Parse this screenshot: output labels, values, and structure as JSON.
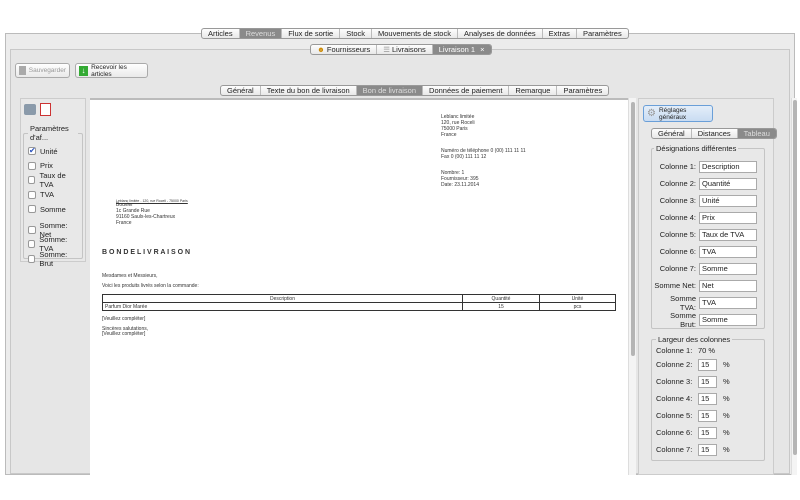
{
  "main_tabs": [
    "Articles",
    "Revenus",
    "Flux de sortie",
    "Stock",
    "Mouvements de stock",
    "Analyses de données",
    "Extras",
    "Paramètres"
  ],
  "sub_tabs": {
    "fournisseurs": "Fournisseurs",
    "livraisons": "Livraisons",
    "livraison1": "Livraison 1",
    "close": "×"
  },
  "toolbar": {
    "save": "Sauvegarder",
    "receive": "Recevoir les articles"
  },
  "doc_tabs": [
    "Général",
    "Texte du bon de livraison",
    "Bon de livraison",
    "Données de paiement",
    "Remarque",
    "Paramètres"
  ],
  "left": {
    "legend": "Paramètres d'af...",
    "items": [
      {
        "label": "Unité",
        "checked": true
      },
      {
        "label": "Prix",
        "checked": false
      },
      {
        "label": "Taux de TVA",
        "checked": false
      },
      {
        "label": "TVA",
        "checked": false
      },
      {
        "label": "Somme",
        "checked": false
      },
      {
        "label": "Somme: Net",
        "checked": false
      },
      {
        "label": "Somme: TVA",
        "checked": false
      },
      {
        "label": "Somme: Brut",
        "checked": false
      }
    ]
  },
  "document": {
    "sender": [
      "Leblanc limitée",
      "120, rue Roceli",
      "75000 Paris",
      "France"
    ],
    "contact": [
      "Numéro de téléphone 0 (00) 111 11 11",
      "Fax 0 (00) 111 11 12"
    ],
    "info": [
      "Nombre: 1",
      "Fournisseur: 395",
      "Date: 23.11.2014"
    ],
    "return_line": "Leblanc limitée - 120, rue Roceli - 75000 Paris",
    "recipient": [
      "Bouvier",
      "1c Grande Rue",
      "91160 Saulx-les-Chartreux",
      "France"
    ],
    "title": "B O N D E L I V R A I S O N",
    "greeting": "Mesdames et Messieurs,",
    "intro": "Voici les produits livrés selon la commande:",
    "table": {
      "headers": [
        "Description",
        "Quantité",
        "Unité"
      ],
      "rows": [
        [
          "Parfum Dior Marée",
          "15",
          "pcs"
        ]
      ]
    },
    "placeholder1": "[Veuillez compléter]",
    "closing": "Sincères salutations,",
    "placeholder2": "[Veuillez compléter]"
  },
  "right": {
    "settings_button": "Réglages généraux",
    "tabs": [
      "Général",
      "Distances",
      "Tableau"
    ],
    "designations_legend": "Désignations différentes",
    "designations": [
      {
        "label": "Colonne 1:",
        "value": "Description"
      },
      {
        "label": "Colonne 2:",
        "value": "Quantité"
      },
      {
        "label": "Colonne 3:",
        "value": "Unité"
      },
      {
        "label": "Colonne 4:",
        "value": "Prix"
      },
      {
        "label": "Colonne 5:",
        "value": "Taux de TVA"
      },
      {
        "label": "Colonne 6:",
        "value": "TVA"
      },
      {
        "label": "Colonne 7:",
        "value": "Somme"
      },
      {
        "label": "Somme Net:",
        "value": "Net"
      },
      {
        "label": "Somme TVA:",
        "value": "TVA"
      },
      {
        "label": "Somme Brut:",
        "value": "Somme"
      }
    ],
    "widths_legend": "Largeur des colonnes",
    "col1_label": "Colonne 1:",
    "col1_value": "70 %",
    "widths": [
      {
        "label": "Colonne 2:",
        "value": "15"
      },
      {
        "label": "Colonne 3:",
        "value": "15"
      },
      {
        "label": "Colonne 4:",
        "value": "15"
      },
      {
        "label": "Colonne 5:",
        "value": "15"
      },
      {
        "label": "Colonne 6:",
        "value": "15"
      },
      {
        "label": "Colonne 7:",
        "value": "15"
      }
    ],
    "unit": "%"
  }
}
